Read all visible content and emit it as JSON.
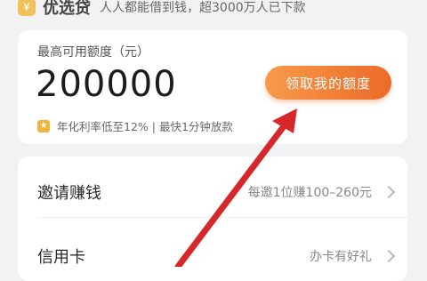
{
  "banner": {
    "title": "优选贷",
    "slogan": "人人都能借到钱，超3000万人已下款"
  },
  "credit": {
    "label": "最高可用额度（元）",
    "amount": "200000",
    "claim_label": "领取我的额度",
    "rate_info": "年化利率低至12% | 最快1分钟放款"
  },
  "menu": {
    "items": [
      {
        "title": "邀请赚钱",
        "subtitle": "每邀1位赚100–260元"
      },
      {
        "title": "信用卡",
        "subtitle": "办卡有好礼"
      }
    ]
  },
  "colors": {
    "accent": "#ec6a2a",
    "arrow": "#d62828",
    "background": "#f2f2f4"
  }
}
